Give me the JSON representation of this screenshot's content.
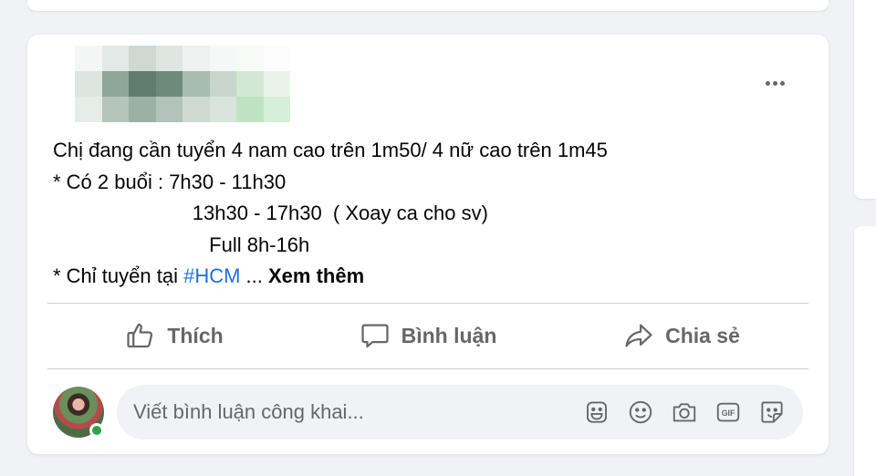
{
  "post": {
    "text_lines": [
      "Chị đang cần tuyển 4 nam cao trên 1m50/ 4 nữ cao trên 1m45",
      "* Có 2 buổi : 7h30 - 11h30",
      "                         13h30 - 17h30  ( Xoay ca cho sv)",
      "                            Full 8h-16h"
    ],
    "last_line_prefix": "* Chỉ tuyển tại ",
    "hashtag": "#HCM",
    "ellipsis": " ... ",
    "see_more": "Xem thêm"
  },
  "actions": {
    "like": "Thích",
    "comment": "Bình luận",
    "share": "Chia sẻ"
  },
  "comment_box": {
    "placeholder": "Viết bình luận công khai..."
  },
  "icons": {
    "more": "more-options-icon",
    "like": "thumbs-up-icon",
    "comment": "speech-bubble-icon",
    "share": "share-arrow-icon",
    "avatar_sticker": "avatar-sticker-icon",
    "emoji": "emoji-icon",
    "camera": "camera-icon",
    "gif": "gif-icon",
    "sticker": "sticker-icon"
  },
  "colors": {
    "hashtag": "#216fdb",
    "action_text": "#65676b",
    "online": "#31a24c"
  }
}
